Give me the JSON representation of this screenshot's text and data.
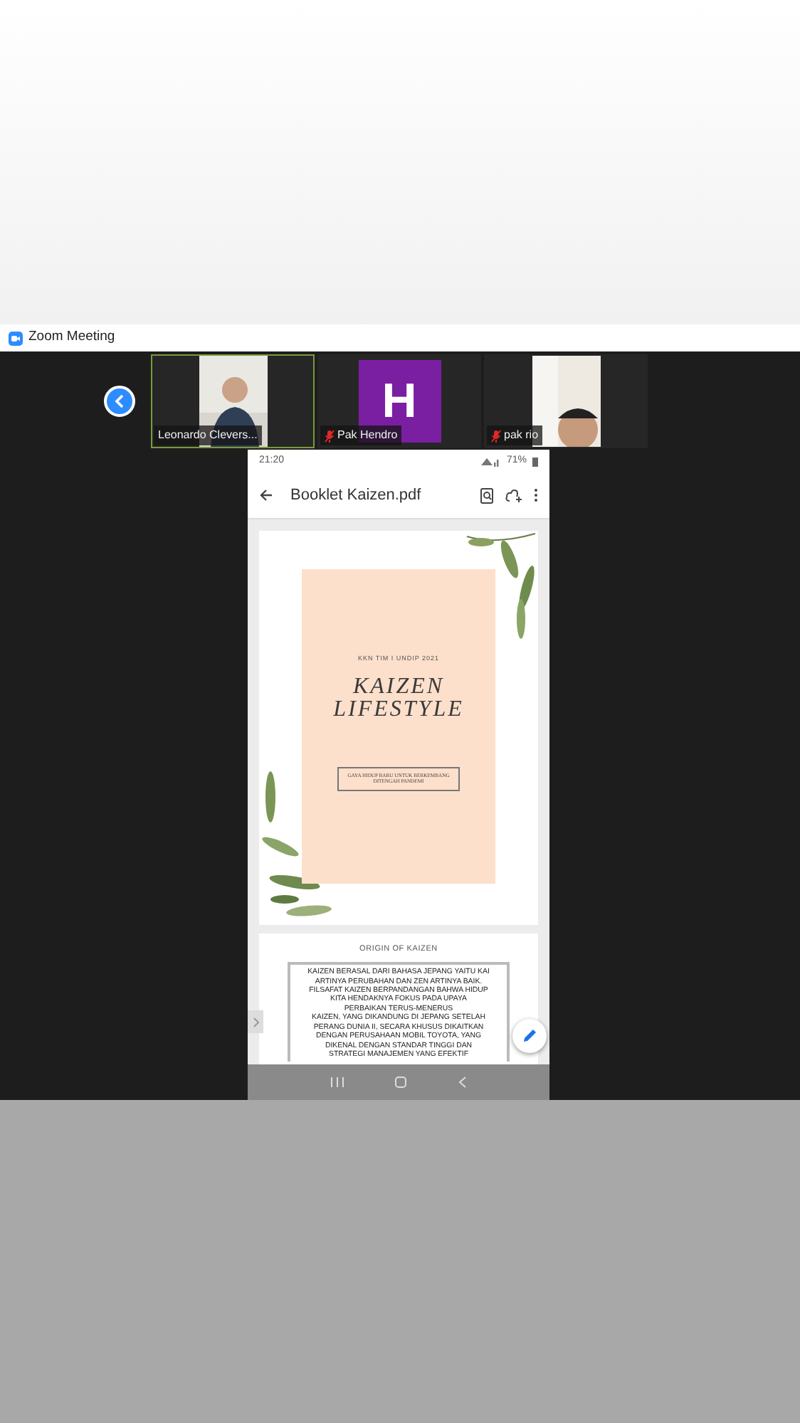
{
  "window": {
    "title": "Zoom Meeting"
  },
  "participants": [
    {
      "name": "Leonardo Clevers...",
      "kind": "video",
      "muted": false,
      "active": true
    },
    {
      "name": "Pak Hendro",
      "kind": "avatar",
      "initial": "H",
      "color": "#7b1fa2",
      "muted": true,
      "active": false
    },
    {
      "name": "pak rio",
      "kind": "video",
      "muted": true,
      "active": false
    }
  ],
  "phone": {
    "status_bar": {
      "time": "21:20",
      "battery": "71%"
    },
    "toolbar": {
      "title": "Booklet Kaizen.pdf"
    },
    "cover": {
      "subtitle": "KKN TIM I UNDIP 2021",
      "title_lines": [
        "KAIZEN",
        "LIFESTYLE"
      ],
      "tagline": "GAYA HIDUP BARU UNTUK BERKEMBANG DITENGAH PANDEMI"
    },
    "page": {
      "heading": "ORIGIN OF KAIZEN",
      "paragraphs": [
        [
          "KAIZEN BERASAL DARI BAHASA JEPANG YAITU KAI",
          "ARTINYA PERUBAHAN DAN ZEN ARTINYA BAIK.",
          "FILSAFAT KAIZEN BERPANDANGAN BAHWA HIDUP",
          "KITA HENDAKNYA FOKUS PADA UPAYA",
          "PERBAIKAN TERUS-MENERUS"
        ],
        [
          "KAIZEN, YANG DIKANDUNG DI JEPANG SETELAH",
          "PERANG DUNIA II, SECARA KHUSUS DIKAITKAN",
          "DENGAN PERUSAHAAN MOBIL TOYOTA, YANG",
          "DIKENAL DENGAN STANDAR TINGGI DAN",
          "STRATEGI MANAJEMEN YANG EFEKTIF"
        ]
      ]
    }
  }
}
